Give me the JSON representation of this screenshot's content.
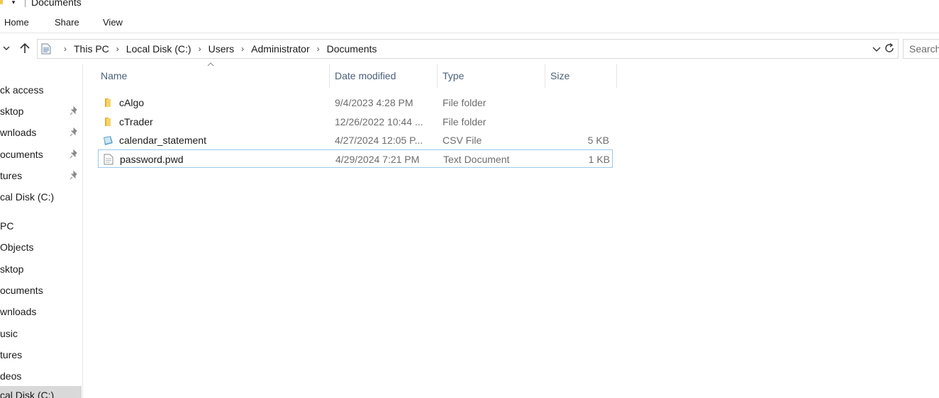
{
  "window": {
    "title": "Documents"
  },
  "ribbon": {
    "tabs": [
      "Home",
      "Share",
      "View"
    ]
  },
  "address": {
    "crumbs": [
      "This PC",
      "Local Disk (C:)",
      "Users",
      "Administrator",
      "Documents"
    ],
    "search_placeholder": "Search"
  },
  "navpane": {
    "items": [
      {
        "label": "ck access",
        "pinned": false
      },
      {
        "label": "sktop",
        "pinned": true
      },
      {
        "label": "wnloads",
        "pinned": true
      },
      {
        "label": "ocuments",
        "pinned": true
      },
      {
        "label": "tures",
        "pinned": true
      },
      {
        "label": "cal Disk (C:)",
        "pinned": false
      },
      {
        "label": " PC",
        "pinned": false
      },
      {
        "label": " Objects",
        "pinned": false
      },
      {
        "label": "sktop",
        "pinned": false
      },
      {
        "label": "ocuments",
        "pinned": false
      },
      {
        "label": "wnloads",
        "pinned": false
      },
      {
        "label": "usic",
        "pinned": false
      },
      {
        "label": "tures",
        "pinned": false
      },
      {
        "label": "deos",
        "pinned": false
      },
      {
        "label": "cal Disk (C:)",
        "pinned": false
      }
    ]
  },
  "filelist": {
    "columns": {
      "name": "Name",
      "date": "Date modified",
      "type": "Type",
      "size": "Size"
    },
    "rows": [
      {
        "icon": "folder-icon",
        "name": "cAlgo",
        "date": "9/4/2023 4:28 PM",
        "type": "File folder",
        "size": ""
      },
      {
        "icon": "folder-icon",
        "name": "cTrader",
        "date": "12/26/2022 10:44 ...",
        "type": "File folder",
        "size": ""
      },
      {
        "icon": "csv-file-icon",
        "name": "calendar_statement",
        "date": "4/27/2024 12:05 P...",
        "type": "CSV File",
        "size": "5 KB"
      },
      {
        "icon": "text-file-icon",
        "name": "password.pwd",
        "date": "4/29/2024 7:21 PM",
        "type": "Text Document",
        "size": "1 KB"
      }
    ]
  },
  "colors": {
    "folder": "#f2c84b",
    "focus_border": "#99c9ef",
    "header_text": "#4c607a"
  }
}
